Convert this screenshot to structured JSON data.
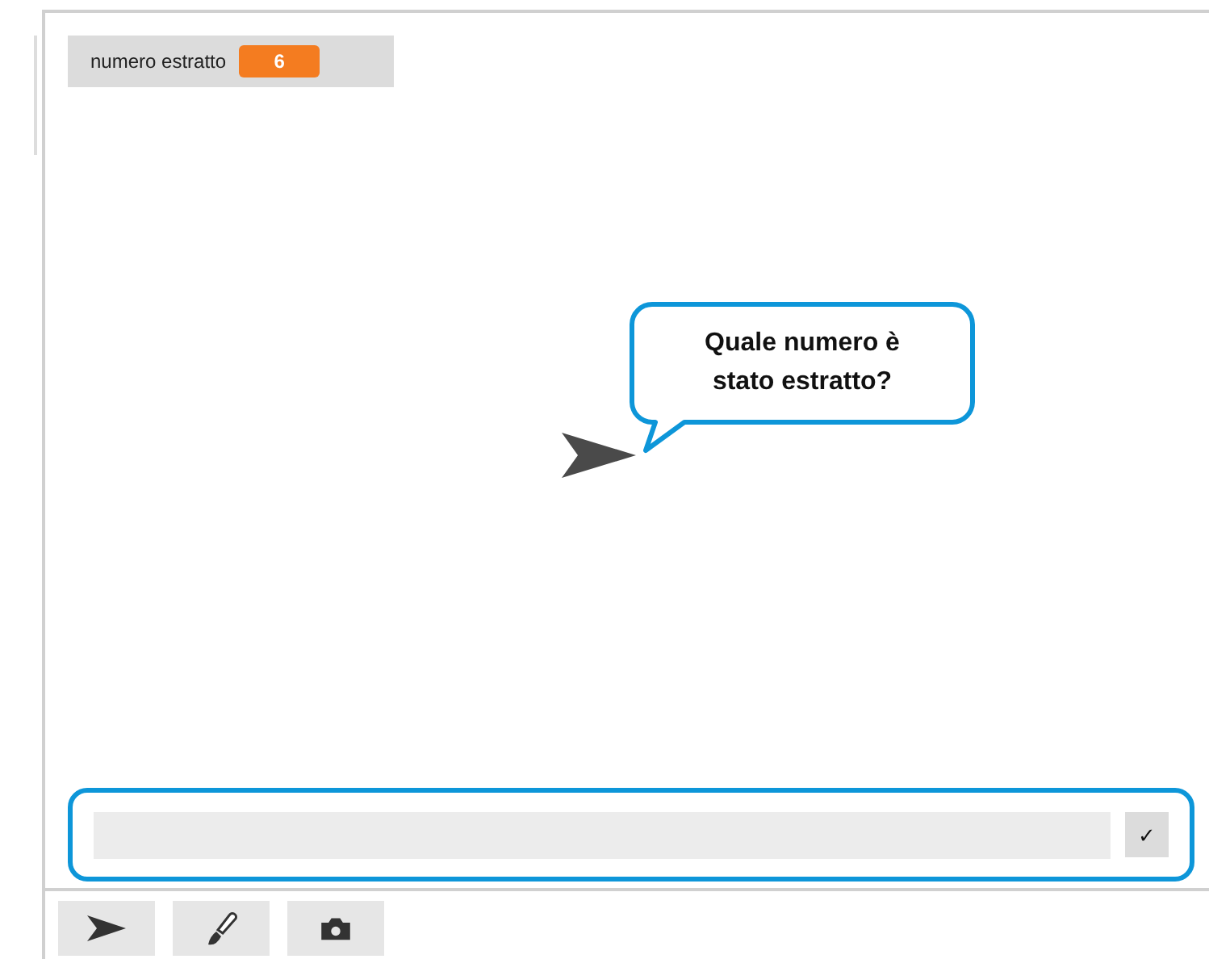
{
  "stage": {
    "monitor": {
      "label": "numero estratto",
      "value": "6"
    },
    "speech_bubble": {
      "text": "Quale numero è stato estratto?"
    },
    "answer": {
      "submit": "✓"
    }
  },
  "toolbar": [
    {
      "kind": "sprite"
    },
    {
      "kind": "brush"
    },
    {
      "kind": "camera"
    }
  ]
}
